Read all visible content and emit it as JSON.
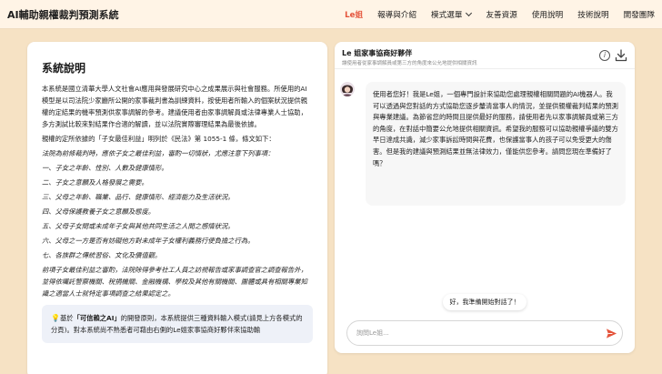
{
  "header": {
    "brand": "AI輔助親權裁判預測系統",
    "nav": [
      {
        "label": "Le姐",
        "active": true,
        "dropdown": false
      },
      {
        "label": "報導與介紹",
        "active": false,
        "dropdown": false
      },
      {
        "label": "模式選單",
        "active": false,
        "dropdown": true
      },
      {
        "label": "友善資源",
        "active": false,
        "dropdown": false
      },
      {
        "label": "使用說明",
        "active": false,
        "dropdown": false
      },
      {
        "label": "技術說明",
        "active": false,
        "dropdown": false
      },
      {
        "label": "開發團隊",
        "active": false,
        "dropdown": false
      }
    ]
  },
  "left": {
    "title": "系統說明",
    "intro": "本系統是國立清華大學人文社會AI應用與發展研究中心之成果展示與社會服務。所使用的AI模型是以司法院少家廳所公開的家事裁判書為訓練資料，按使用者所輸入的個案狀況提供親權的定結果的機率預測供家事調解的參考。建議使用者由家事調解員或法律專業人士協助，多方測試比較來對結果作合適的解讀，並以法院實際審理結果為最後依據。",
    "law_intro": "親權的定所依據的「子女最佳利益」明列於《民法》第 1055-1 條，條文如下：",
    "law_lines": [
      "法院為前條裁判時，應依子女之最佳利益，審酌一切情狀，尤應注意下列事項：",
      "一、子女之年齡、性別、人數及健康情形。",
      "二、子女之意願及人格發展之需要。",
      "三、父母之年齡、職業、品行、健康情形、經濟能力及生活狀況。",
      "四、父母保護教養子女之意願及態度。",
      "五、父母子女間或未成年子女與其他共同生活之人間之感情狀況。",
      "六、父母之一方是否有妨礙他方對未成年子女權利義務行使負擔之行為。",
      "七、各族群之傳統習俗、文化及價值觀。",
      "前項子女最佳利益之審酌，法院除得參考社工人員之訪視報告或家事調查官之調查報告外，並得依囑託警察機關、稅捐機關、金融機構、學校及其他有關機關、團體或具有相關專業知識之適當人士就特定事項調查之結果認定之。"
    ],
    "note_prefix": "基於",
    "note_bold": "「可信賴之AI」",
    "note_rest": "的開發原則，本系統提供三種資料輸入模式(請見上方各模式的分頁)。對本系統尚不熟悉者可藉由右側的Le姐家事協商好夥伴來協助輸"
  },
  "chat": {
    "title": "Le 姐家事協商好夥伴",
    "subtitle": "讓使用者從家事調解員或第三方的角度來公允地提供相關資訊",
    "bot_message": "使用者您好！我是Le姐，一個專門設計來協助您處理親權相關問題的AI機器人。我可以透過與您對話的方式協助您逐步釐清當事人的情況，並提供親權裁判結果的預測與專業建議。為節省您的時間且提供最好的服務，請使用者先以家事調解員或第三方的角度，在對話中簡要公允地提供相關資訊。希望我的服務可以協助親權爭議的雙方早日達成共識，減少家事訴訟時間與花費，也保護當事人的孩子可以免受更大的傷害。但是我的建議與預測結果並無法律效力，僅能供您參考。請問您現在準備好了嗎？",
    "user_message": "好，我準備開始對話了！",
    "input_placeholder": "詢問Le姐...",
    "accent_color": "#e4533a"
  },
  "icons": {
    "info": "info-icon",
    "download": "download-icon",
    "send": "send-icon",
    "bulb": "lightbulb-icon",
    "avatar": "avatar"
  }
}
